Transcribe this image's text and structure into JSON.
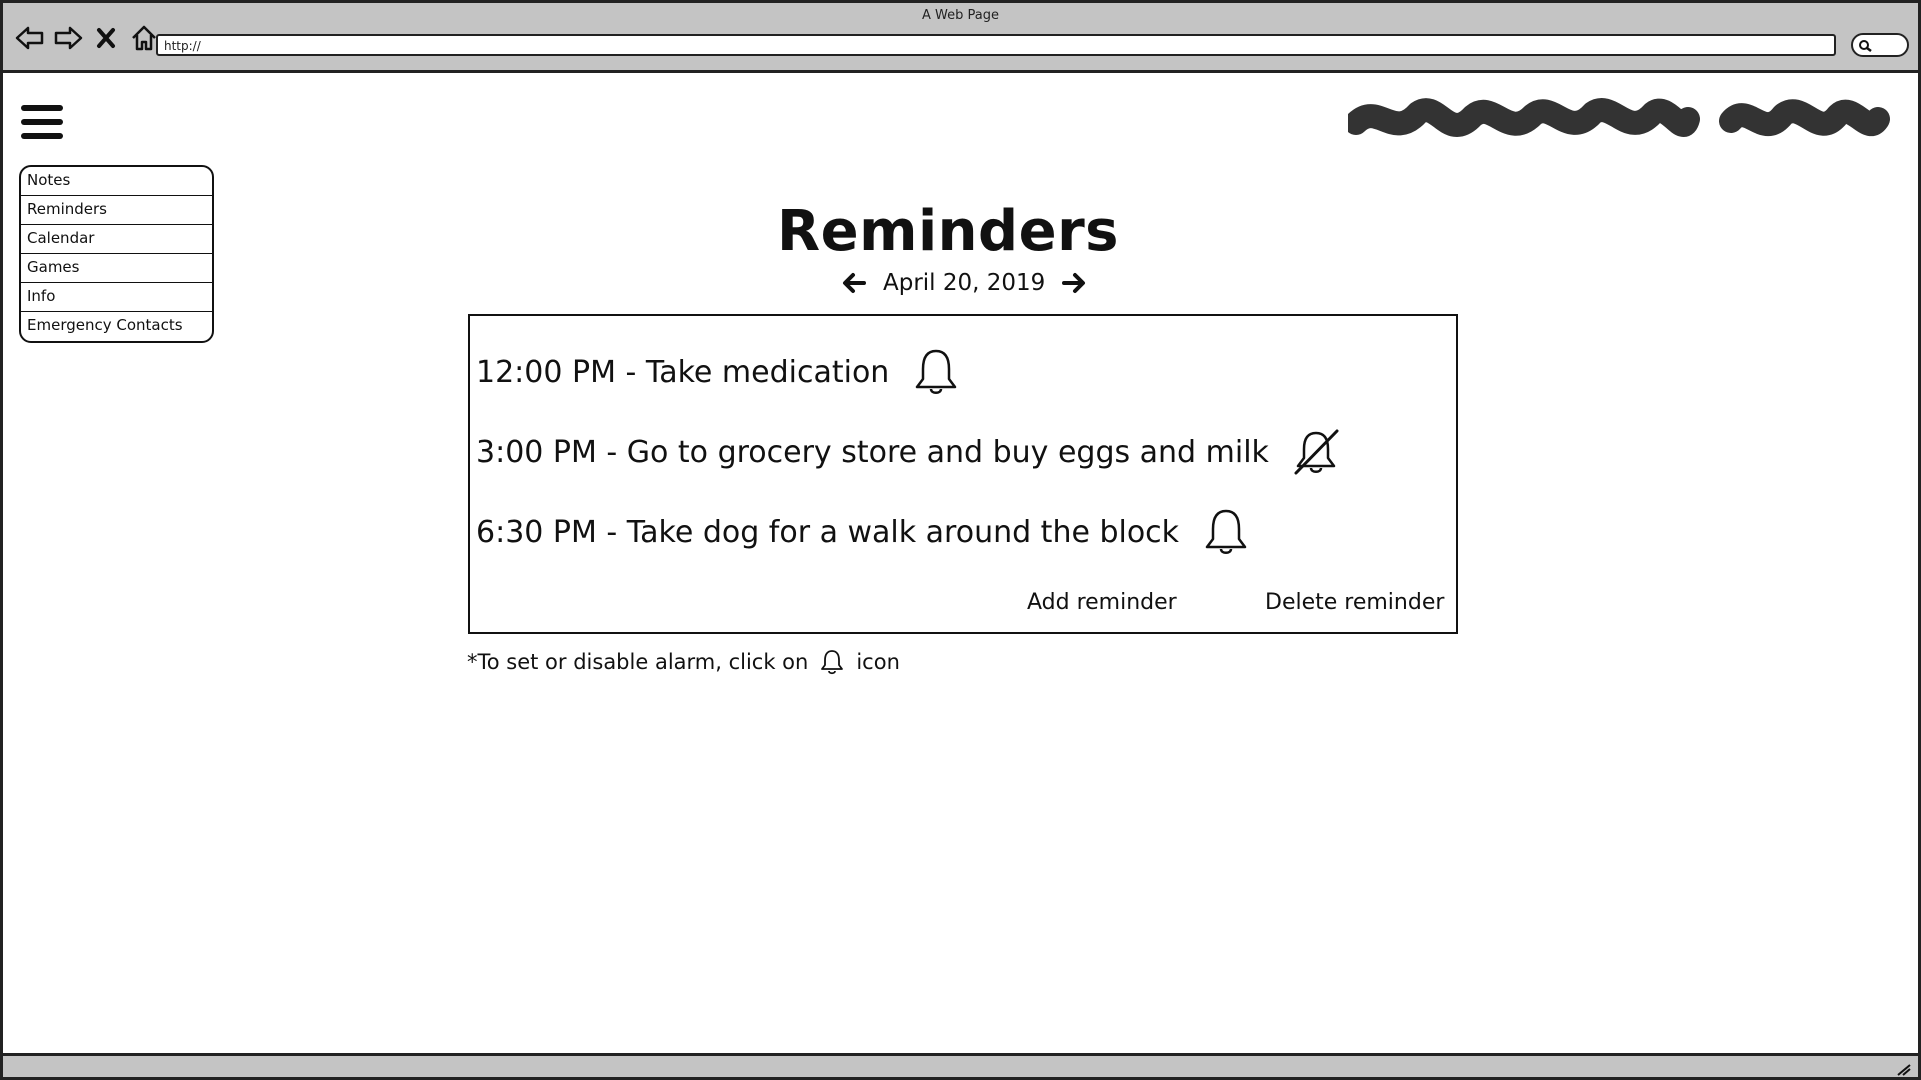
{
  "browser": {
    "window_title": "A Web Page",
    "url": "http://"
  },
  "sidebar": {
    "items": [
      {
        "label": "Notes"
      },
      {
        "label": "Reminders"
      },
      {
        "label": "Calendar"
      },
      {
        "label": "Games"
      },
      {
        "label": "Info"
      },
      {
        "label": "Emergency Contacts"
      }
    ]
  },
  "header": {
    "title": "Reminders",
    "date": "April 20, 2019"
  },
  "reminders": [
    {
      "text": "12:00 PM - Take medication",
      "alarm": "on",
      "icon": "bell-icon"
    },
    {
      "text": "3:00 PM - Go to grocery store and buy eggs and milk",
      "alarm": "off",
      "icon": "bell-off-icon"
    },
    {
      "text": "6:30 PM - Take dog for a walk around the block",
      "alarm": "on",
      "icon": "bell-icon"
    }
  ],
  "actions": {
    "add_label": "Add reminder",
    "delete_label": "Delete reminder"
  },
  "footnote": {
    "before_icon": "*To set or disable alarm, click on",
    "after_icon": "icon"
  },
  "icons": {
    "nav": [
      "back-arrow-icon",
      "forward-arrow-icon",
      "close-icon",
      "home-icon"
    ],
    "menu": "hamburger-icon",
    "search": "search-icon",
    "date_prev": "arrow-left-icon",
    "date_next": "arrow-right-icon"
  }
}
